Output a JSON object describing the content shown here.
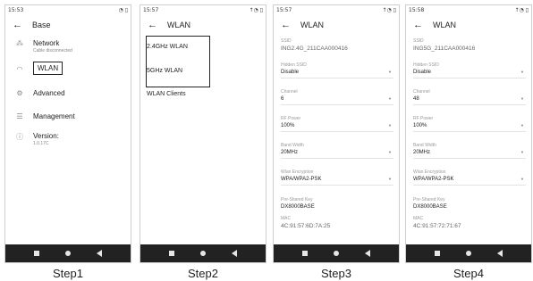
{
  "step1": {
    "status": {
      "time": "15:53",
      "icons": "◔ ▯"
    },
    "title": "Base",
    "menu": [
      {
        "label": "Network",
        "sub": "Cable disconnected",
        "icon": "network-icon"
      },
      {
        "label": "WLAN",
        "sub": "",
        "icon": "wifi-icon"
      },
      {
        "label": "Advanced",
        "sub": "",
        "icon": "settings-gear-icon"
      },
      {
        "label": "Management",
        "sub": "",
        "icon": "menu-lines-icon"
      },
      {
        "label": "Version:",
        "sub": "1.0.17C",
        "icon": "info-icon"
      }
    ],
    "caption": "Step1"
  },
  "step2": {
    "status": {
      "time": "15:57",
      "icons": "↑◔ ▯"
    },
    "title": "WLAN",
    "items": [
      "2.4GHz WLAN",
      "5GHz WLAN",
      "WLAN Clients"
    ],
    "caption": "Step2"
  },
  "step3": {
    "status": {
      "time": "15:57",
      "icons": "↑◔ ▯"
    },
    "title": "WLAN",
    "fields": [
      {
        "label": "SSID",
        "value": "ING2.4G_211CAA000416"
      },
      {
        "label": "Hidden SSID",
        "value": "Disable"
      },
      {
        "label": "Channel",
        "value": "6"
      },
      {
        "label": "RF Power",
        "value": "100%"
      },
      {
        "label": "Band Width",
        "value": "20MHz"
      },
      {
        "label": "Wlan Encryption",
        "value": "WPA/WPA2-PSK"
      },
      {
        "label": "Pre-Shared Key",
        "value": "DX8000BASE"
      },
      {
        "label": "MAC",
        "value": "4C:91:57:6D:7A:25"
      }
    ],
    "caption": "Step3"
  },
  "step4": {
    "status": {
      "time": "15:58",
      "icons": "↑◔ ▯"
    },
    "title": "WLAN",
    "fields": [
      {
        "label": "SSID",
        "value": "ING5G_211CAA000416"
      },
      {
        "label": "Hidden SSID",
        "value": "Disable"
      },
      {
        "label": "Channel",
        "value": "48"
      },
      {
        "label": "RF Power",
        "value": "100%"
      },
      {
        "label": "Band Width",
        "value": "20MHz"
      },
      {
        "label": "Wlan Encryption",
        "value": "WPA/WPA2-PSK"
      },
      {
        "label": "Pre-Shared Key",
        "value": "DX8000BASE"
      },
      {
        "label": "MAC",
        "value": "4C:91:57:72:71:67"
      }
    ],
    "caption": "Step4"
  }
}
